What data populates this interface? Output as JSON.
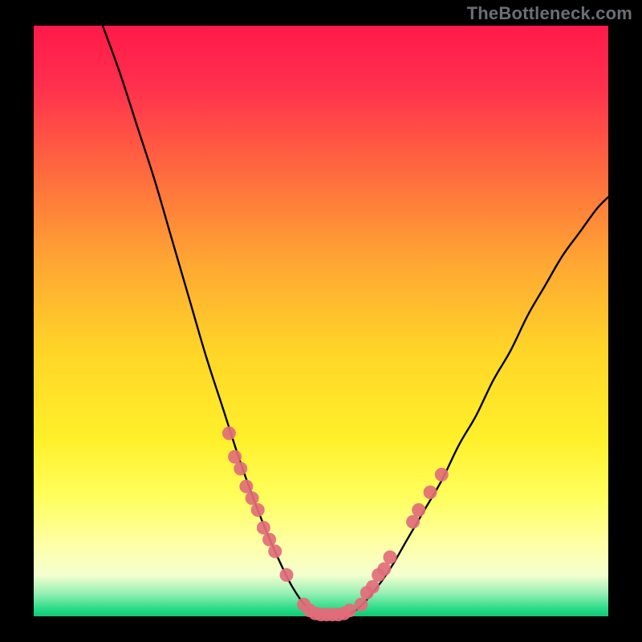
{
  "watermark": "TheBottleneck.com",
  "colors": {
    "bg_black": "#000000",
    "grad_top": "#ff1f4b",
    "grad_mid": "#ffe926",
    "grad_bottom_yellow": "#ffff6b",
    "grad_green": "#2be08a",
    "curve": "#000000",
    "dots": "#e26c7a",
    "watermark": "#6b6e73"
  },
  "chart_data": {
    "type": "line",
    "title": "",
    "xlabel": "",
    "ylabel": "",
    "x_range": [
      0,
      100
    ],
    "y_range": [
      0,
      100
    ],
    "curve_description": "V-shaped bottleneck curve; y=100 at x≈12, descends to y≈0 near x≈48, remains near 0 until x≈56, rises to y≈70 at x=100",
    "curve_points": [
      {
        "x": 12,
        "y": 100
      },
      {
        "x": 15,
        "y": 92
      },
      {
        "x": 18,
        "y": 83
      },
      {
        "x": 21,
        "y": 74
      },
      {
        "x": 24,
        "y": 64
      },
      {
        "x": 27,
        "y": 54
      },
      {
        "x": 30,
        "y": 44
      },
      {
        "x": 33,
        "y": 35
      },
      {
        "x": 36,
        "y": 26
      },
      {
        "x": 39,
        "y": 18
      },
      {
        "x": 42,
        "y": 11
      },
      {
        "x": 45,
        "y": 5
      },
      {
        "x": 48,
        "y": 1
      },
      {
        "x": 50,
        "y": 0
      },
      {
        "x": 53,
        "y": 0
      },
      {
        "x": 56,
        "y": 1
      },
      {
        "x": 59,
        "y": 4
      },
      {
        "x": 62,
        "y": 8
      },
      {
        "x": 65,
        "y": 13
      },
      {
        "x": 68,
        "y": 18
      },
      {
        "x": 71,
        "y": 23
      },
      {
        "x": 74,
        "y": 29
      },
      {
        "x": 77,
        "y": 34
      },
      {
        "x": 80,
        "y": 40
      },
      {
        "x": 83,
        "y": 45
      },
      {
        "x": 86,
        "y": 51
      },
      {
        "x": 89,
        "y": 56
      },
      {
        "x": 92,
        "y": 61
      },
      {
        "x": 95,
        "y": 65
      },
      {
        "x": 98,
        "y": 69
      },
      {
        "x": 100,
        "y": 71
      }
    ],
    "dot_points_left": [
      {
        "x": 34,
        "y": 31
      },
      {
        "x": 35,
        "y": 27
      },
      {
        "x": 36,
        "y": 25
      },
      {
        "x": 37,
        "y": 22
      },
      {
        "x": 38,
        "y": 20
      },
      {
        "x": 39,
        "y": 18
      },
      {
        "x": 40,
        "y": 15
      },
      {
        "x": 41,
        "y": 13
      },
      {
        "x": 42,
        "y": 11
      },
      {
        "x": 44,
        "y": 7
      }
    ],
    "dot_points_bottom": [
      {
        "x": 47,
        "y": 2
      },
      {
        "x": 48,
        "y": 1
      },
      {
        "x": 49,
        "y": 0.5
      },
      {
        "x": 50,
        "y": 0.3
      },
      {
        "x": 51,
        "y": 0.3
      },
      {
        "x": 52,
        "y": 0.3
      },
      {
        "x": 53,
        "y": 0.3
      },
      {
        "x": 54,
        "y": 0.5
      },
      {
        "x": 55,
        "y": 1
      }
    ],
    "dot_points_right": [
      {
        "x": 57,
        "y": 2
      },
      {
        "x": 58,
        "y": 4
      },
      {
        "x": 59,
        "y": 5
      },
      {
        "x": 60,
        "y": 7
      },
      {
        "x": 61,
        "y": 8
      },
      {
        "x": 62,
        "y": 10
      },
      {
        "x": 66,
        "y": 16
      },
      {
        "x": 67,
        "y": 18
      },
      {
        "x": 69,
        "y": 21
      },
      {
        "x": 71,
        "y": 24
      }
    ],
    "gradient_bands_y_pct": {
      "top_red_end": 20,
      "yellow_center": 60,
      "pale_yellow_band_top": 78,
      "pale_yellow_band_bottom": 90,
      "green_band_top": 95,
      "bottom_black": 100
    }
  }
}
